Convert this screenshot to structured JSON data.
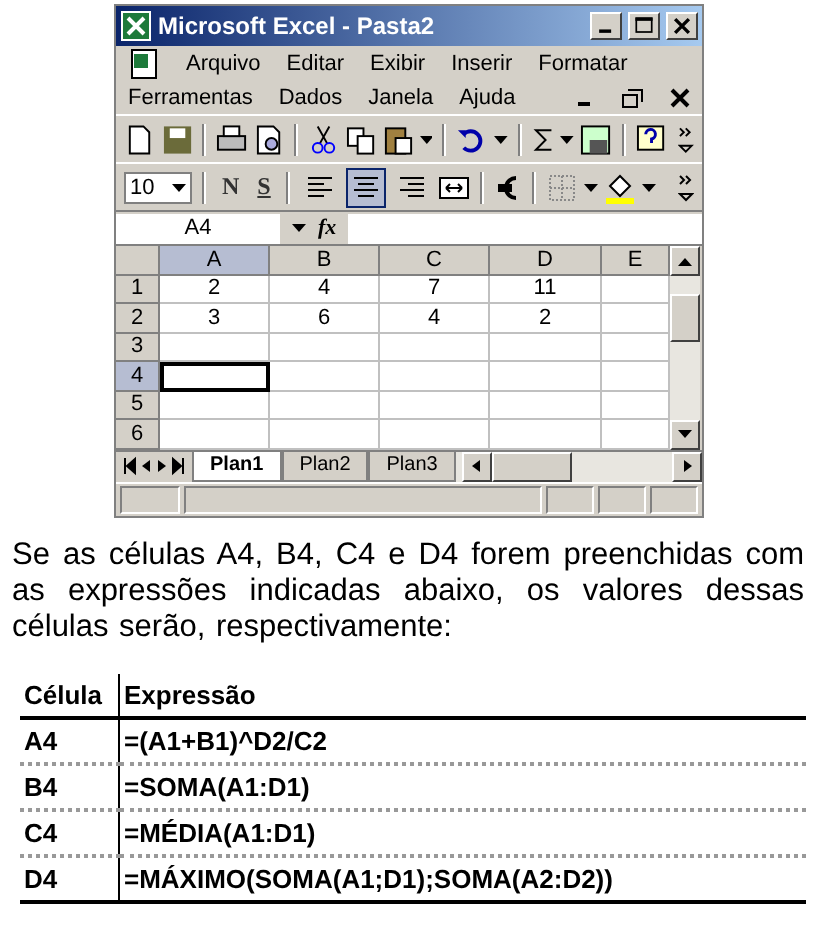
{
  "window": {
    "title": "Microsoft Excel - Pasta2"
  },
  "menus": [
    {
      "items": [
        "Arquivo",
        "Editar",
        "Exibir",
        "Inserir",
        "Formatar"
      ]
    },
    {
      "items": [
        "Ferramentas",
        "Dados",
        "Janela",
        "Ajuda"
      ]
    }
  ],
  "format_toolbar": {
    "font_size": "10",
    "bold_label": "N",
    "underline_label": "S",
    "align": [
      {
        "selected": false
      },
      {
        "selected": true
      },
      {
        "selected": false
      }
    ]
  },
  "formula_bar": {
    "name_box": "A4",
    "function_label": "fx"
  },
  "sheet": {
    "columns": [
      {
        "label": "A",
        "selected": true
      },
      {
        "label": "B",
        "selected": false
      },
      {
        "label": "C",
        "selected": false
      },
      {
        "label": "D",
        "selected": false
      },
      {
        "label": "E",
        "selected": false
      }
    ],
    "rows": [
      {
        "label": "1",
        "selected": false,
        "cells": [
          "2",
          "4",
          "7",
          "11"
        ]
      },
      {
        "label": "2",
        "selected": false,
        "cells": [
          "3",
          "6",
          "4",
          "2"
        ]
      },
      {
        "label": "3",
        "selected": false
      },
      {
        "label": "4",
        "selected": true
      },
      {
        "label": "5",
        "selected": false
      },
      {
        "label": "6",
        "selected": false
      }
    ]
  },
  "sheet_tabs": [
    {
      "label": "Plan1",
      "selected": true
    },
    {
      "label": "Plan2",
      "selected": false
    },
    {
      "label": "Plan3",
      "selected": false
    }
  ],
  "question": "Se as células A4, B4, C4 e D4 forem preenchidas com as expressões indicadas abaixo, os valores dessas células serão, respectivamente:",
  "table": {
    "columns": [
      "Célula",
      "Expressão"
    ],
    "rows": [
      {
        "cell": "A4",
        "expression": "=(A1+B1)^D2/C2"
      },
      {
        "cell": "B4",
        "expression": "=SOMA(A1:D1)"
      },
      {
        "cell": "C4",
        "expression": "=MÉDIA(A1:D1)"
      },
      {
        "cell": "D4",
        "expression": "=MÁXIMO(SOMA(A1;D1);SOMA(A2:D2))"
      }
    ]
  }
}
